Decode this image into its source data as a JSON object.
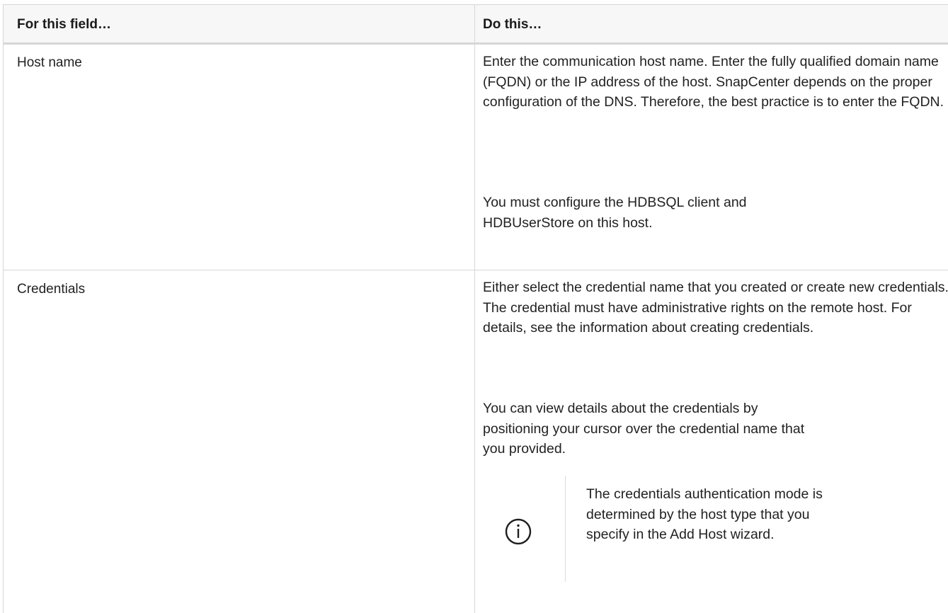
{
  "table": {
    "header": {
      "field_col": "For this field…",
      "action_col": "Do this…"
    },
    "rows": [
      {
        "field": "Host name",
        "paragraphs": [
          "Enter the communication host name. Enter the fully qualified domain name (FQDN) or the IP address of the host. SnapCenter depends on the proper configuration of the DNS. Therefore, the best practice is to enter the FQDN.",
          "You must configure the HDBSQL client and HDBUserStore on this host."
        ]
      },
      {
        "field": "Credentials",
        "paragraphs": [
          "Either select the credential name that you created or create new credentials. The credential must have administrative rights on the remote host. For details, see the information about creating credentials.",
          "You can view details about the credentials by positioning your cursor over the credential name that you provided."
        ],
        "note": {
          "icon": "info-icon",
          "text": "The credentials authentication mode is determined by the host type that you specify in the Add Host wizard."
        }
      }
    ]
  },
  "colors": {
    "border": "#d6d6d6",
    "header_bg": "#f7f7f7",
    "text": "#222222",
    "icon": "#1f1f1f"
  }
}
